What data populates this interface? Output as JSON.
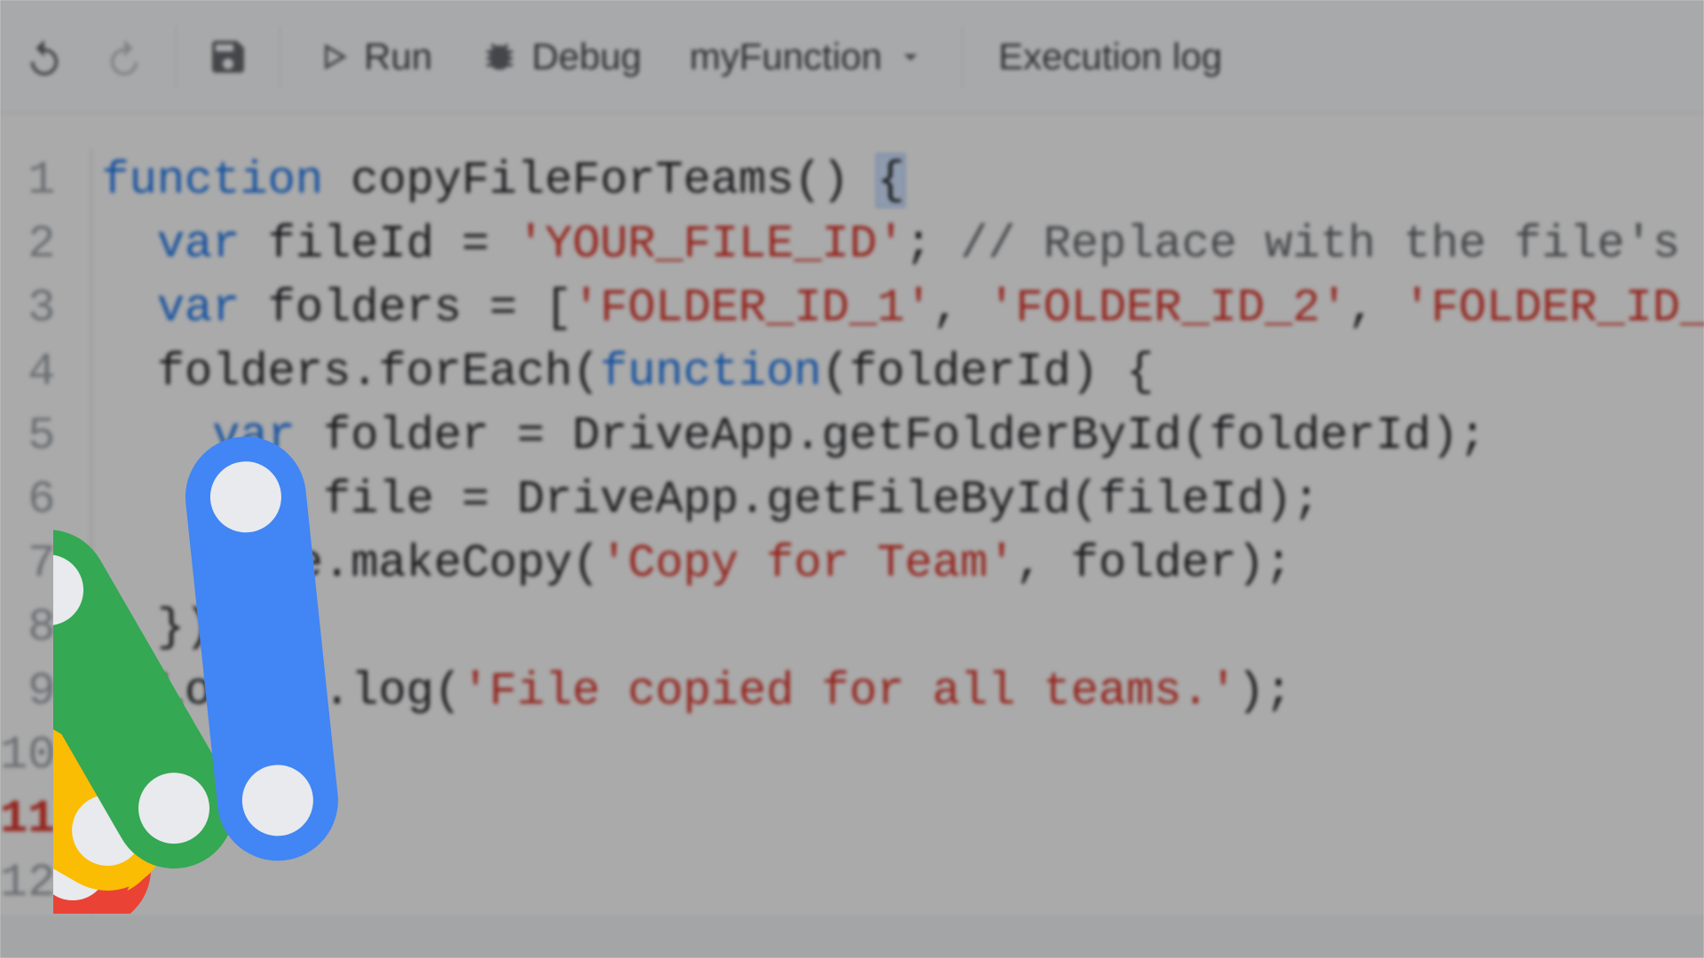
{
  "toolbar": {
    "run_label": "Run",
    "debug_label": "Debug",
    "func_selected": "myFunction",
    "execlog_label": "Execution log"
  },
  "code": {
    "lines": [
      {
        "n": "1",
        "seg": [
          [
            "kw",
            "function "
          ],
          [
            "fn",
            "copyFileForTeams"
          ],
          [
            "",
            "() "
          ],
          [
            "brace",
            "{"
          ]
        ]
      },
      {
        "n": "2",
        "seg": [
          [
            "",
            "  "
          ],
          [
            "kw",
            "var"
          ],
          [
            "",
            " fileId = "
          ],
          [
            "str",
            "'YOUR_FILE_ID'"
          ],
          [
            "",
            "; "
          ],
          [
            "com",
            "// Replace with the file's"
          ]
        ]
      },
      {
        "n": "3",
        "seg": [
          [
            "",
            "  "
          ],
          [
            "kw",
            "var"
          ],
          [
            "",
            " folders = ["
          ],
          [
            "str",
            "'FOLDER_ID_1'"
          ],
          [
            "",
            ", "
          ],
          [
            "str",
            "'FOLDER_ID_2'"
          ],
          [
            "",
            ", "
          ],
          [
            "str",
            "'FOLDER_ID_"
          ]
        ]
      },
      {
        "n": "4",
        "seg": [
          [
            "",
            ""
          ]
        ]
      },
      {
        "n": "5",
        "seg": [
          [
            "",
            "  folders.forEach("
          ],
          [
            "kw",
            "function"
          ],
          [
            "",
            "(folderId) {"
          ]
        ]
      },
      {
        "n": "6",
        "seg": [
          [
            "",
            "    "
          ],
          [
            "kw",
            "var"
          ],
          [
            "",
            " folder = DriveApp.getFolderById(folderId);"
          ]
        ]
      },
      {
        "n": "7",
        "seg": [
          [
            "",
            "    "
          ],
          [
            "kw",
            "var"
          ],
          [
            "",
            " file = DriveApp.getFileById(fileId);"
          ]
        ]
      },
      {
        "n": "8",
        "seg": [
          [
            "",
            "    file.makeCopy("
          ],
          [
            "str",
            "'Copy for Team'"
          ],
          [
            "",
            ", folder);"
          ]
        ]
      },
      {
        "n": "9",
        "seg": [
          [
            "",
            "  });"
          ]
        ]
      },
      {
        "n": "10",
        "seg": [
          [
            "",
            "  Logger.log("
          ],
          [
            "str",
            "'File copied for all teams.'"
          ],
          [
            "",
            ");"
          ]
        ]
      },
      {
        "n": "11",
        "seg": [
          [
            "",
            "}"
          ]
        ]
      },
      {
        "n": "12",
        "seg": [
          [
            "",
            ""
          ]
        ]
      }
    ]
  },
  "logo_colors": {
    "red": "#ea4335",
    "yellow": "#fbbc04",
    "green": "#34a853",
    "blue": "#4285f4",
    "hole": "#f1f3f4"
  }
}
